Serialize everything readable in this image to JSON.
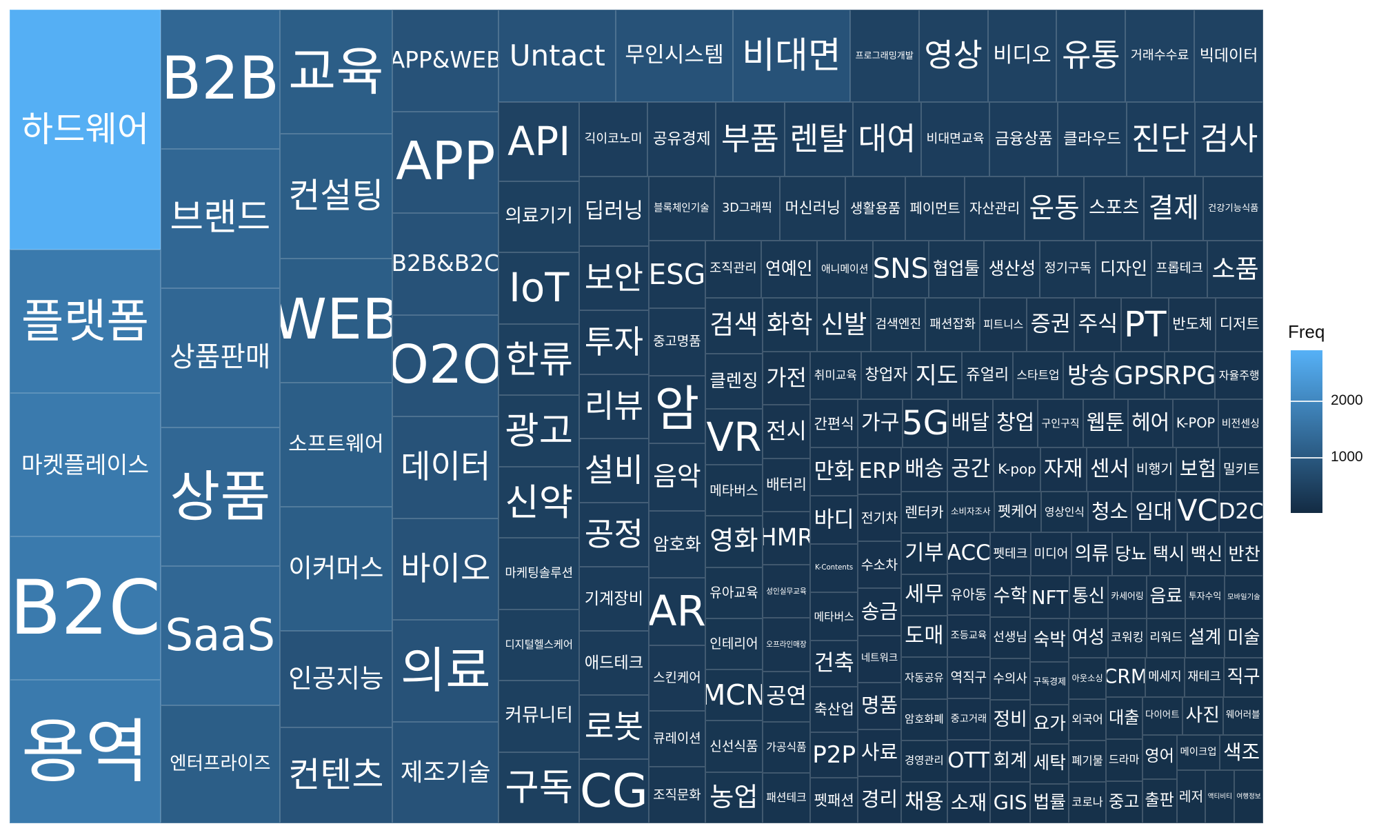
{
  "chart_data": {
    "type": "treemap",
    "legend": {
      "title": "Freq",
      "ticks": [
        1000,
        2000
      ],
      "max": 2900,
      "low_color": "#132b43",
      "high_color": "#56b1f7"
    },
    "items": [
      {
        "label": "하드웨어",
        "value": 2850
      },
      {
        "label": "플랫폼",
        "value": 1700
      },
      {
        "label": "마켓플레이스",
        "value": 1700
      },
      {
        "label": "B2C",
        "value": 1700
      },
      {
        "label": "용역",
        "value": 1700
      },
      {
        "label": "B2B",
        "value": 1300
      },
      {
        "label": "브랜드",
        "value": 1300
      },
      {
        "label": "상품판매",
        "value": 1300
      },
      {
        "label": "상품",
        "value": 1300
      },
      {
        "label": "SaaS",
        "value": 1300
      },
      {
        "label": "엔터프라이즈",
        "value": 1100
      },
      {
        "label": "교육",
        "value": 1100
      },
      {
        "label": "컨설팅",
        "value": 1100
      },
      {
        "label": "WEB",
        "value": 1100
      },
      {
        "label": "소프트웨어",
        "value": 1100
      },
      {
        "label": "이커머스",
        "value": 1100
      },
      {
        "label": "인공지능",
        "value": 850
      },
      {
        "label": "컨텐츠",
        "value": 850
      },
      {
        "label": "APP&WEB",
        "value": 850
      },
      {
        "label": "APP",
        "value": 850
      },
      {
        "label": "B2B&B2C",
        "value": 850
      },
      {
        "label": "O2O",
        "value": 850
      },
      {
        "label": "데이터",
        "value": 850
      },
      {
        "label": "바이오",
        "value": 850
      },
      {
        "label": "의료",
        "value": 850
      },
      {
        "label": "제조기술",
        "value": 850
      },
      {
        "label": "Untact",
        "value": 850
      },
      {
        "label": "무인시스템",
        "value": 850
      },
      {
        "label": "비대면",
        "value": 850
      },
      {
        "label": "프로그래밍개발",
        "value": 500
      },
      {
        "label": "영상",
        "value": 500
      },
      {
        "label": "비디오",
        "value": 500
      },
      {
        "label": "유통",
        "value": 500
      },
      {
        "label": "거래수수료",
        "value": 500
      },
      {
        "label": "빅데이터",
        "value": 500
      },
      {
        "label": "API",
        "value": 500
      },
      {
        "label": "의료기기",
        "value": 450
      },
      {
        "label": "IoT",
        "value": 450
      },
      {
        "label": "한류",
        "value": 450
      },
      {
        "label": "광고",
        "value": 450
      },
      {
        "label": "신약",
        "value": 450
      },
      {
        "label": "마케팅솔루션",
        "value": 450
      },
      {
        "label": "디지털헬스케어",
        "value": 450
      },
      {
        "label": "커뮤니티",
        "value": 450
      },
      {
        "label": "구독",
        "value": 450
      },
      {
        "label": "긱이코노미",
        "value": 400
      },
      {
        "label": "공유경제",
        "value": 400
      },
      {
        "label": "부품",
        "value": 400
      },
      {
        "label": "렌탈",
        "value": 400
      },
      {
        "label": "대여",
        "value": 400
      },
      {
        "label": "비대면교육",
        "value": 400
      },
      {
        "label": "금융상품",
        "value": 400
      },
      {
        "label": "클라우드",
        "value": 400
      },
      {
        "label": "진단",
        "value": 400
      },
      {
        "label": "검사",
        "value": 400
      },
      {
        "label": "딥러닝",
        "value": 380
      },
      {
        "label": "보안",
        "value": 350
      },
      {
        "label": "투자",
        "value": 350
      },
      {
        "label": "리뷰",
        "value": 350
      },
      {
        "label": "블록체인기술",
        "value": 330
      },
      {
        "label": "설비",
        "value": 350
      },
      {
        "label": "공정",
        "value": 350
      },
      {
        "label": "기계장비",
        "value": 350
      },
      {
        "label": "애드테크",
        "value": 350
      },
      {
        "label": "로봇",
        "value": 350
      },
      {
        "label": "CG",
        "value": 350
      },
      {
        "label": "3D그래픽",
        "value": 330
      },
      {
        "label": "머신러닝",
        "value": 330
      },
      {
        "label": "생활용품",
        "value": 300
      },
      {
        "label": "페이먼트",
        "value": 300
      },
      {
        "label": "자산관리",
        "value": 300
      },
      {
        "label": "운동",
        "value": 300
      },
      {
        "label": "스포츠",
        "value": 300
      },
      {
        "label": "결제",
        "value": 300
      },
      {
        "label": "건강기능식품",
        "value": 300
      },
      {
        "label": "ESG",
        "value": 300
      },
      {
        "label": "중고명품",
        "value": 300
      },
      {
        "label": "암",
        "value": 300
      },
      {
        "label": "음악",
        "value": 300
      },
      {
        "label": "암호화",
        "value": 300
      },
      {
        "label": "스킨케어",
        "value": 290
      },
      {
        "label": "AR",
        "value": 300
      },
      {
        "label": "큐레이션",
        "value": 250
      },
      {
        "label": "조직문화",
        "value": 250
      },
      {
        "label": "조직관리",
        "value": 250
      },
      {
        "label": "연예인",
        "value": 250
      },
      {
        "label": "애니메이션",
        "value": 250
      },
      {
        "label": "SNS",
        "value": 250
      },
      {
        "label": "협업툴",
        "value": 250
      },
      {
        "label": "생산성",
        "value": 250
      },
      {
        "label": "정기구독",
        "value": 250
      },
      {
        "label": "디자인",
        "value": 250
      },
      {
        "label": "프롭테크",
        "value": 250
      },
      {
        "label": "소품",
        "value": 250
      },
      {
        "label": "검색",
        "value": 250
      },
      {
        "label": "클렌징",
        "value": 250
      },
      {
        "label": "VR",
        "value": 250
      },
      {
        "label": "메타버스",
        "value": 230
      },
      {
        "label": "영화",
        "value": 230
      },
      {
        "label": "유아교육",
        "value": 230
      },
      {
        "label": "인테리어",
        "value": 230
      },
      {
        "label": "MCN",
        "value": 230
      },
      {
        "label": "신선식품",
        "value": 230
      },
      {
        "label": "농업",
        "value": 230
      },
      {
        "label": "화학",
        "value": 230
      },
      {
        "label": "신발",
        "value": 230
      },
      {
        "label": "검색엔진",
        "value": 230
      },
      {
        "label": "패션잡화",
        "value": 230
      },
      {
        "label": "피트니스",
        "value": 200
      },
      {
        "label": "증권",
        "value": 200
      },
      {
        "label": "주식",
        "value": 200
      },
      {
        "label": "PT",
        "value": 200
      },
      {
        "label": "반도체",
        "value": 200
      },
      {
        "label": "디저트",
        "value": 200
      },
      {
        "label": "가전",
        "value": 200
      },
      {
        "label": "전시",
        "value": 200
      },
      {
        "label": "배터리",
        "value": 200
      },
      {
        "label": "HMR",
        "value": 200
      },
      {
        "label": "성인실무교육",
        "value": 200
      },
      {
        "label": "오프라인매장",
        "value": 200
      },
      {
        "label": "공연",
        "value": 190
      },
      {
        "label": "가공식품",
        "value": 190
      },
      {
        "label": "패션테크",
        "value": 190
      },
      {
        "label": "취미교육",
        "value": 190
      },
      {
        "label": "창업자",
        "value": 190
      },
      {
        "label": "지도",
        "value": 190
      },
      {
        "label": "쥬얼리",
        "value": 190
      },
      {
        "label": "스타트업",
        "value": 190
      },
      {
        "label": "방송",
        "value": 190
      },
      {
        "label": "GPS",
        "value": 190
      },
      {
        "label": "RPG",
        "value": 190
      },
      {
        "label": "자율주행",
        "value": 180
      },
      {
        "label": "간편식",
        "value": 180
      },
      {
        "label": "만화",
        "value": 180
      },
      {
        "label": "바디",
        "value": 180
      },
      {
        "label": "K-Contents",
        "value": 180
      },
      {
        "label": "메타버스",
        "value": 180
      },
      {
        "label": "건축",
        "value": 170
      },
      {
        "label": "축산업",
        "value": 170
      },
      {
        "label": "P2P",
        "value": 170
      },
      {
        "label": "펫패션",
        "value": 170
      },
      {
        "label": "가구",
        "value": 170
      },
      {
        "label": "5G",
        "value": 170
      },
      {
        "label": "배달",
        "value": 170
      },
      {
        "label": "창업",
        "value": 170
      },
      {
        "label": "구인구직",
        "value": 170
      },
      {
        "label": "웹툰",
        "value": 170
      },
      {
        "label": "헤어",
        "value": 170
      },
      {
        "label": "K-POP",
        "value": 170
      },
      {
        "label": "비전센싱",
        "value": 170
      },
      {
        "label": "ERP",
        "value": 160
      },
      {
        "label": "전기차",
        "value": 160
      },
      {
        "label": "수소차",
        "value": 160
      },
      {
        "label": "송금",
        "value": 160
      },
      {
        "label": "네트워크",
        "value": 160
      },
      {
        "label": "명품",
        "value": 160
      },
      {
        "label": "사료",
        "value": 160
      },
      {
        "label": "경리",
        "value": 160
      },
      {
        "label": "배송",
        "value": 160
      },
      {
        "label": "공간",
        "value": 160
      },
      {
        "label": "K-pop",
        "value": 160
      },
      {
        "label": "자재",
        "value": 160
      },
      {
        "label": "센서",
        "value": 160
      },
      {
        "label": "비행기",
        "value": 150
      },
      {
        "label": "보험",
        "value": 150
      },
      {
        "label": "밀키트",
        "value": 150
      },
      {
        "label": "렌터카",
        "value": 150
      },
      {
        "label": "기부",
        "value": 150
      },
      {
        "label": "세무",
        "value": 150
      },
      {
        "label": "도매",
        "value": 150
      },
      {
        "label": "자동공유",
        "value": 150
      },
      {
        "label": "암호화폐",
        "value": 150
      },
      {
        "label": "경영관리",
        "value": 150
      },
      {
        "label": "채용",
        "value": 150
      },
      {
        "label": "소비자조사",
        "value": 150
      },
      {
        "label": "펫케어",
        "value": 150
      },
      {
        "label": "영상인식",
        "value": 150
      },
      {
        "label": "청소",
        "value": 140
      },
      {
        "label": "임대",
        "value": 140
      },
      {
        "label": "VC",
        "value": 140
      },
      {
        "label": "D2C",
        "value": 140
      },
      {
        "label": "ACC",
        "value": 140
      },
      {
        "label": "유아동",
        "value": 140
      },
      {
        "라벨": "",
        "label": "조등교육",
        "value": 140
      },
      {
        "label": "역직구",
        "value": 140
      },
      {
        "label": "중고거래",
        "value": 140
      },
      {
        "label": "OTT",
        "value": 140
      },
      {
        "label": "소재",
        "value": 140
      },
      {
        "label": "펫테크",
        "value": 140
      },
      {
        "label": "미디어",
        "value": 140
      },
      {
        "label": "의류",
        "value": 140
      },
      {
        "label": "당뇨",
        "value": 130
      },
      {
        "label": "택시",
        "value": 130
      },
      {
        "label": "백신",
        "value": 130
      },
      {
        "label": "반찬",
        "value": 130
      },
      {
        "label": "수학",
        "value": 130
      },
      {
        "label": "선생님",
        "value": 130
      },
      {
        "label": "수의사",
        "value": 130
      },
      {
        "label": "정비",
        "value": 130
      },
      {
        "label": "회계",
        "value": 130
      },
      {
        "label": "GIS",
        "value": 130
      },
      {
        "label": "NFT",
        "value": 130
      },
      {
        "label": "통신",
        "value": 130
      },
      {
        "label": "카세어링",
        "value": 130
      },
      {
        "label": "음료",
        "value": 130
      },
      {
        "label": "투자수익",
        "value": 130
      },
      {
        "label": "모바일기술",
        "value": 130
      },
      {
        "label": "숙박",
        "value": 130
      },
      {
        "label": "구독경제",
        "value": 130
      },
      {
        "label": "요가",
        "value": 120
      },
      {
        "label": "세탁",
        "value": 120
      },
      {
        "label": "법률",
        "value": 120
      },
      {
        "label": "여성",
        "value": 120
      },
      {
        "label": "코워킹",
        "value": 120
      },
      {
        "label": "리워드",
        "value": 120
      },
      {
        "label": "설계",
        "value": 120
      },
      {
        "label": "미술",
        "value": 120
      },
      {
        "label": "아웃소싱",
        "value": 120
      },
      {
        "label": "외국어",
        "value": 120
      },
      {
        "label": "폐기물",
        "value": 120
      },
      {
        "label": "코로나",
        "value": 120
      },
      {
        "label": "CRM",
        "value": 120
      },
      {
        "label": "메세지",
        "value": 120
      },
      {
        "label": "재테크",
        "value": 120
      },
      {
        "label": "직구",
        "value": 120
      },
      {
        "label": "대출",
        "value": 120
      },
      {
        "label": "드라마",
        "value": 120
      },
      {
        "label": "중고",
        "value": 120
      },
      {
        "label": "다이어트",
        "value": 120
      },
      {
        "label": "사진",
        "value": 120
      },
      {
        "label": "웨어러블",
        "value": 120
      },
      {
        "label": "영어",
        "value": 120
      },
      {
        "label": "출판",
        "value": 120
      },
      {
        "label": "메이크업",
        "value": 120
      },
      {
        "label": "색조",
        "value": 120
      },
      {
        "label": "레저",
        "value": 120
      },
      {
        "label": "액티비티",
        "value": 120
      },
      {
        "label": "여행정보",
        "value": 120
      }
    ]
  }
}
